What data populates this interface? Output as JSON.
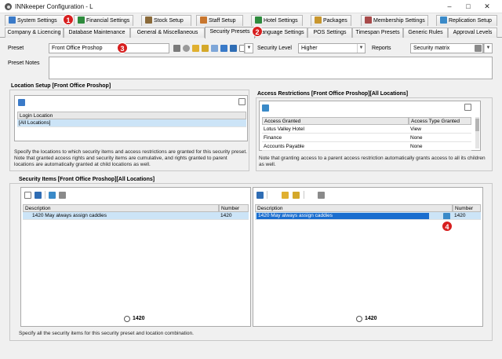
{
  "window": {
    "title": "INNkeeper Configuration - L",
    "controls": [
      "–",
      "□",
      "✕"
    ]
  },
  "tabs_row1": [
    {
      "label": "System Settings",
      "icon": "system-settings-icon",
      "color": "#3a7ac8"
    },
    {
      "label": "Financial Settings",
      "icon": "financial-icon",
      "color": "#2e8b3d"
    },
    {
      "label": "Stock Setup",
      "icon": "stock-icon",
      "color": "#8a6a3a"
    },
    {
      "label": "Staff Setup",
      "icon": "staff-icon",
      "color": "#c8762e"
    },
    {
      "label": "Hotel Settings",
      "icon": "hotel-icon",
      "color": "#2e8b3d"
    },
    {
      "label": "Packages",
      "icon": "packages-icon",
      "color": "#c8962e"
    },
    {
      "label": "Membership Settings",
      "icon": "membership-icon",
      "color": "#a84a4a"
    },
    {
      "label": "Replication Setup",
      "icon": "replication-icon",
      "color": "#3a8ac8"
    }
  ],
  "tabs_row2": [
    {
      "label": "Company & Licencing"
    },
    {
      "label": "Database Maintenance"
    },
    {
      "label": "General & Miscellaneous"
    },
    {
      "label": "Security Presets",
      "active": true
    },
    {
      "label": "Language Settings"
    },
    {
      "label": "POS Settings"
    },
    {
      "label": "Timespan Presets"
    },
    {
      "label": "Generic Rules"
    },
    {
      "label": "Approval Levels"
    }
  ],
  "badges": [
    "1",
    "2",
    "3",
    "4"
  ],
  "preset": {
    "label": "Preset",
    "value": "Front Office Proshop",
    "security_level_label": "Security Level",
    "security_level_value": "Higher",
    "reports_label": "Reports",
    "reports_value": "Security matrix",
    "notes_label": "Preset Notes"
  },
  "location_setup": {
    "title": "Location Setup [Front Office Proshop]",
    "column": "Login Location",
    "rows": [
      "[All Locations]"
    ],
    "note": "Specify the locations to which security items and access restrictions are granted for this security preset. Note that granted access rights and security items are cumulative, and rights granted to parent locations are automatically granted at child locations as well."
  },
  "access_restrictions": {
    "title": "Access Restrictions [Front Office Proshop][All Locations]",
    "columns": [
      "Access Granted",
      "Access Type Granted"
    ],
    "rows": [
      [
        "Lotus Valley Hotel",
        "View"
      ],
      [
        "Finance",
        "None"
      ],
      [
        "Accounts Payable",
        "None"
      ]
    ],
    "note": "Note that granting access to a parent access restriction automatically grants access to all its children as well."
  },
  "security_items": {
    "title": "Security Items [Front Office Proshop][All Locations]",
    "columns": [
      "Description",
      "Number"
    ],
    "left_rows": [
      [
        "1420 May always assign caddies",
        "1420"
      ]
    ],
    "right_rows": [
      [
        "1420 May always assign caddies",
        "1420"
      ]
    ],
    "left_footer": "1420",
    "right_footer": "1420",
    "note": "Specify all the security items for this security preset and location combination."
  }
}
